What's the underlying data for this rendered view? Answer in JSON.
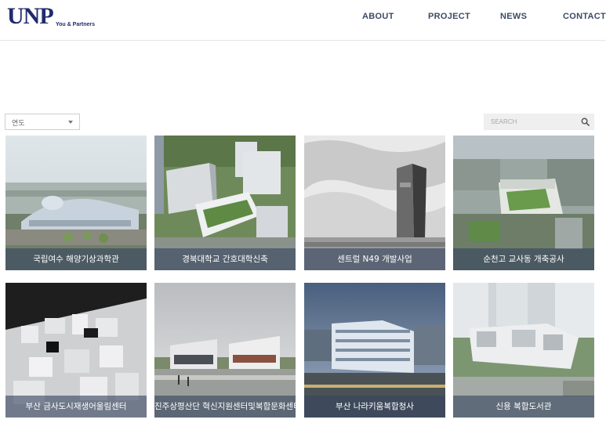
{
  "brand": {
    "logo_text": "UNP",
    "tagline": "You & Partners",
    "color": "#1f2b6e"
  },
  "nav": {
    "items": [
      {
        "label": "ABOUT"
      },
      {
        "label": "PROJECT"
      },
      {
        "label": "NEWS"
      },
      {
        "label": "CONTACT"
      }
    ]
  },
  "filter": {
    "year_label": "연도",
    "search_placeholder": "SEARCH"
  },
  "projects": [
    {
      "title": "국립여수 해양기상과학관"
    },
    {
      "title": "경북대학교 간호대학신축"
    },
    {
      "title": "센트럴 N49 개발사업"
    },
    {
      "title": "순천고 교사동 개축공사"
    },
    {
      "title": "부산 금사도시재생어울림센터"
    },
    {
      "title": "진주상평산단 혁신지원센터및복합문화센터"
    },
    {
      "title": "부산 나라키움복합청사"
    },
    {
      "title": "신용 복합도서관"
    }
  ],
  "colors": {
    "caption_overlay": "#37465f",
    "nav_text": "#3d4a66"
  }
}
